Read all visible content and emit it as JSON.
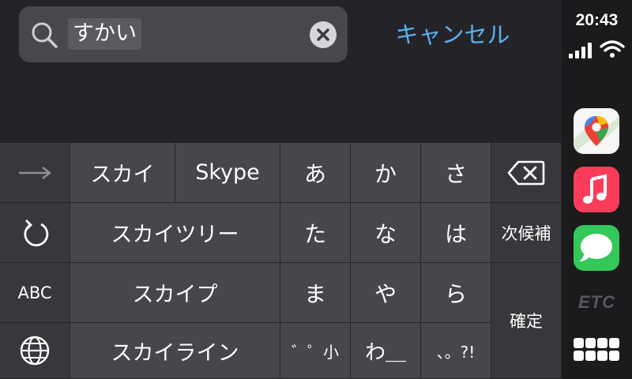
{
  "search": {
    "query": "すかい"
  },
  "cancel_label": "キャンセル",
  "keyboard": {
    "candidates": [
      "スカイ",
      "Skype",
      "スカイツリー",
      "スカイプ",
      "スカイライン"
    ],
    "kana": {
      "a": "あ",
      "ka": "か",
      "sa": "さ",
      "ta": "た",
      "na": "な",
      "ha": "は",
      "ma": "ま",
      "ya": "や",
      "ra": "ら",
      "dakuten": "゛゜小",
      "wa": "わ＿",
      "punct": "、。?!"
    },
    "abc_label": "ABC",
    "next_candidate_label": "次候補",
    "confirm_label": "確定"
  },
  "status": {
    "time": "20:43"
  },
  "dock": {
    "apps": [
      "Maps",
      "Music",
      "Messages"
    ],
    "etc_label": "ETC"
  },
  "colors": {
    "accent": "#5ab1ee",
    "music": "#fa3c5a",
    "messages": "#34c759"
  }
}
